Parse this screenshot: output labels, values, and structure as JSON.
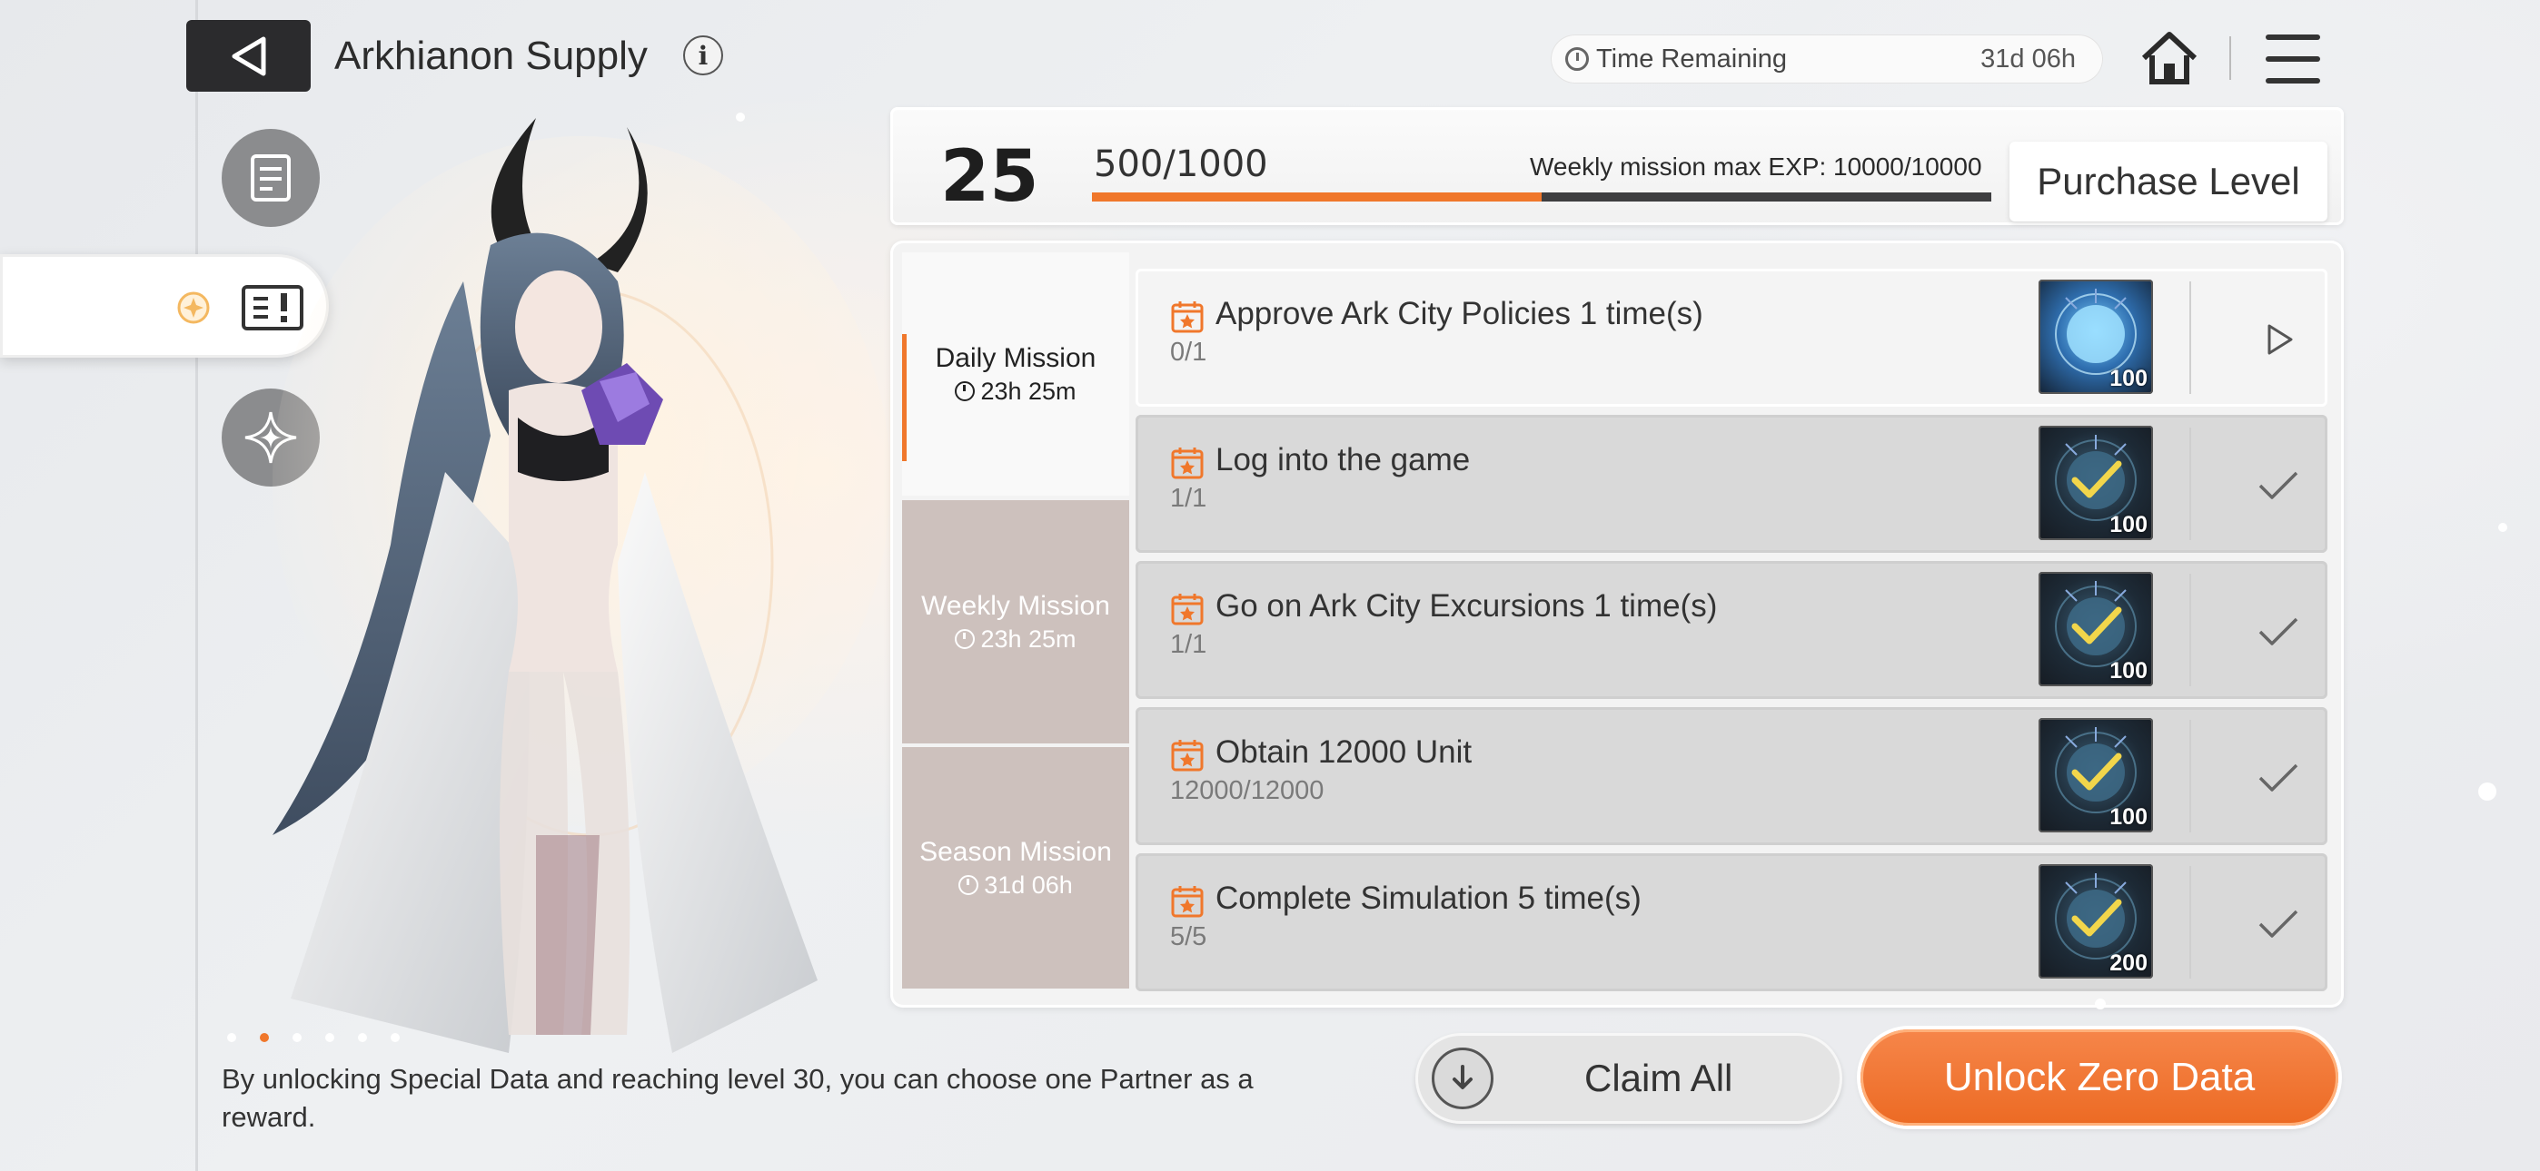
{
  "header": {
    "title": "Arkhianon Supply",
    "info_glyph": "i",
    "time_label": "Time Remaining",
    "time_value": "31d 06h"
  },
  "level": {
    "current": "25",
    "exp_text": "500/1000",
    "exp_fraction": 0.5,
    "weekly_cap": "Weekly mission max EXP: 10000/10000",
    "purchase_label": "Purchase Level"
  },
  "tabs": [
    {
      "name": "Daily Mission",
      "time": "23h 25m",
      "active": true
    },
    {
      "name": "Weekly Mission",
      "time": "23h 25m",
      "active": false
    },
    {
      "name": "Season Mission",
      "time": "31d 06h",
      "active": false
    }
  ],
  "missions": [
    {
      "name": "Approve Ark City Policies 1 time(s)",
      "progress": "0/1",
      "reward": "100",
      "status": "open"
    },
    {
      "name": "Log into the game",
      "progress": "1/1",
      "reward": "100",
      "status": "done"
    },
    {
      "name": "Go on Ark City Excursions 1 time(s)",
      "progress": "1/1",
      "reward": "100",
      "status": "done"
    },
    {
      "name": "Obtain 12000 Unit",
      "progress": "12000/12000",
      "reward": "100",
      "status": "done"
    },
    {
      "name": "Complete Simulation 5 time(s)",
      "progress": "5/5",
      "reward": "200",
      "status": "done"
    }
  ],
  "footer": {
    "note": "By unlocking Special Data and reaching level 30, you can choose one Partner as a reward.",
    "claim_all": "Claim All",
    "unlock": "Unlock Zero Data"
  },
  "icons": {
    "back": "back-triangle-icon",
    "home": "home-icon",
    "menu": "menu-icon",
    "side": [
      "data-card-icon",
      "alert-list-icon",
      "sparkle-star-icon"
    ],
    "mission": "calendar-star-icon",
    "reward": "data-orb-icon",
    "open_action": "play-arrow-icon",
    "done_action": "checkmark-icon"
  },
  "colors": {
    "accent": "#f0772b",
    "tab_inactive": "#cdc1bd",
    "dark_button": "#2b2b2d"
  },
  "carousel": {
    "count": 6,
    "active_index": 1
  }
}
